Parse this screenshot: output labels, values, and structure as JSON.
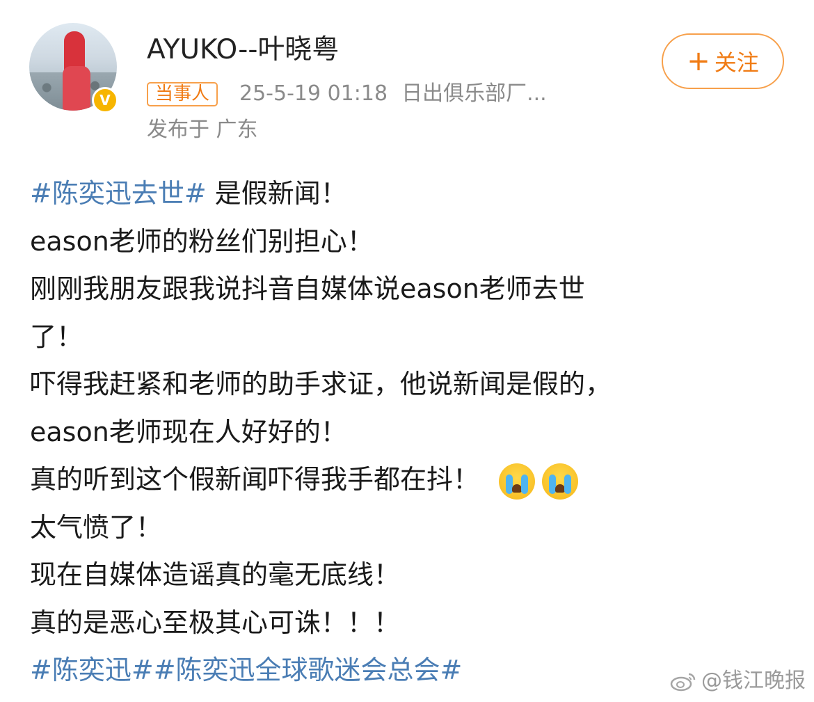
{
  "user": {
    "name": "AYUKO--叶晓粤",
    "verified_mark": "V",
    "badge": "当事人",
    "timestamp": "25-5-19 01:18",
    "source": "日出俱乐部厂...",
    "location": "发布于 广东"
  },
  "follow_button": {
    "icon": "plus-icon",
    "plus": "+",
    "label": "关注"
  },
  "post": {
    "line1_tag": "#陈奕迅去世#",
    "line1_text": " 是假新闻！",
    "line2": "eason老师的粉丝们别担心！",
    "line3": "刚刚我朋友跟我说抖音自媒体说eason老师去世",
    "line4": "了！",
    "line5": "吓得我赶紧和老师的助手求证，他说新闻是假的，",
    "line6": "eason老师现在人好好的！",
    "line7_text": "真的听到这个假新闻吓得我手都在抖！",
    "line7_emojis": [
      "crying-face-emoji",
      "crying-face-emoji"
    ],
    "line8": "太气愤了！",
    "line9": "现在自媒体造谣真的毫无底线！",
    "line10": "真的是恶心至极其心可诛！！！",
    "line11_tag1": "#陈奕迅#",
    "line11_tag2": "#陈奕迅全球歌迷会总会#"
  },
  "watermark": {
    "icon": "weibo-icon",
    "text": "@钱江晚报"
  },
  "colors": {
    "accent": "#f07b14",
    "accent_border": "#f7a04b",
    "hashtag": "#4a7db4",
    "meta": "#8a8a8a",
    "verified": "#f7b500"
  }
}
